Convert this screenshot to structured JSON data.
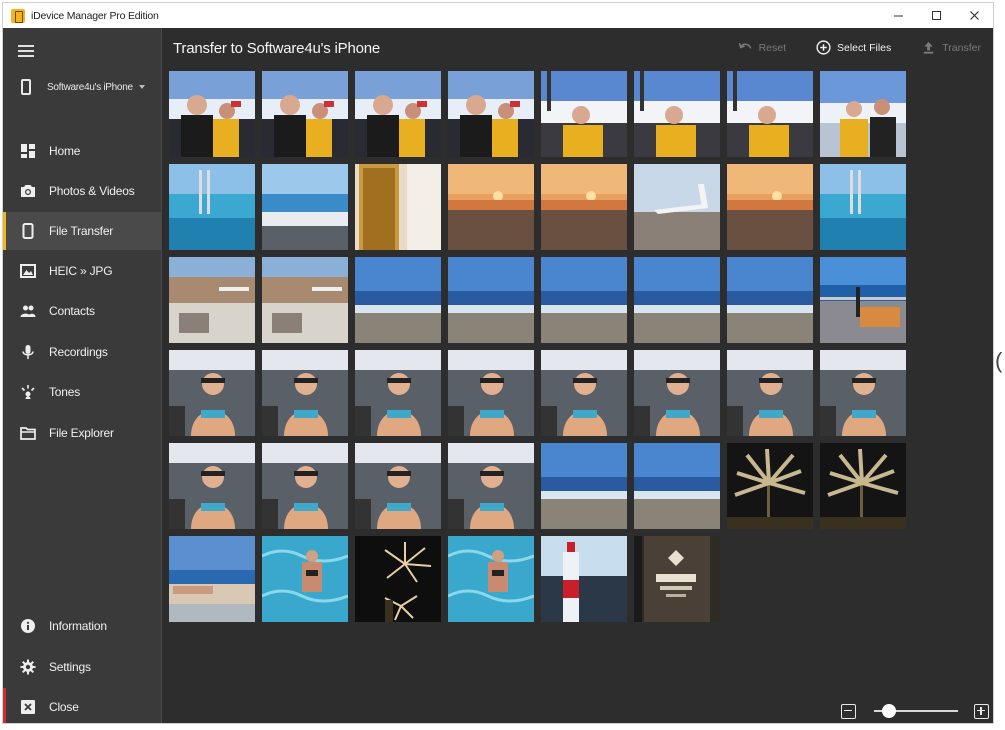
{
  "window": {
    "title": "iDevice Manager Pro Edition",
    "controls": [
      "minimize-icon",
      "maximize-icon",
      "close-icon"
    ]
  },
  "sidebar": {
    "device": "Software4u's iPhone",
    "items": [
      {
        "label": "Home",
        "icon": "home-icon"
      },
      {
        "label": "Photos & Videos",
        "icon": "camera-icon"
      },
      {
        "label": "File Transfer",
        "icon": "phone-icon",
        "active": true
      },
      {
        "label": "HEIC » JPG",
        "icon": "image-convert-icon"
      },
      {
        "label": "Contacts",
        "icon": "contacts-icon"
      },
      {
        "label": "Recordings",
        "icon": "microphone-icon"
      },
      {
        "label": "Tones",
        "icon": "tones-icon"
      },
      {
        "label": "File Explorer",
        "icon": "folder-icon"
      }
    ],
    "bottom_items": [
      {
        "label": "Information",
        "icon": "info-icon"
      },
      {
        "label": "Settings",
        "icon": "gear-icon"
      },
      {
        "label": "Close",
        "icon": "close-box-icon"
      }
    ]
  },
  "main": {
    "title": "Transfer to Software4u's iPhone",
    "toolbar": {
      "reset": "Reset",
      "select_files": "Select Files",
      "transfer": "Transfer"
    }
  },
  "thumbnails": [
    {
      "scene": "ski-selfie"
    },
    {
      "scene": "ski-selfie"
    },
    {
      "scene": "ski-selfie"
    },
    {
      "scene": "ski-selfie"
    },
    {
      "scene": "ski-lift"
    },
    {
      "scene": "ski-lift"
    },
    {
      "scene": "ski-lift"
    },
    {
      "scene": "ski-couple"
    },
    {
      "scene": "pool"
    },
    {
      "scene": "beach"
    },
    {
      "scene": "door"
    },
    {
      "scene": "sunset"
    },
    {
      "scene": "sunset"
    },
    {
      "scene": "airport"
    },
    {
      "scene": "sunset"
    },
    {
      "scene": "pool"
    },
    {
      "scene": "terrace"
    },
    {
      "scene": "terrace"
    },
    {
      "scene": "sea"
    },
    {
      "scene": "sea"
    },
    {
      "scene": "sea"
    },
    {
      "scene": "sea"
    },
    {
      "scene": "sea"
    },
    {
      "scene": "balcony-pool"
    },
    {
      "scene": "selfie-bikini"
    },
    {
      "scene": "selfie-bikini"
    },
    {
      "scene": "selfie-bikini"
    },
    {
      "scene": "selfie-bikini"
    },
    {
      "scene": "selfie-bikini"
    },
    {
      "scene": "selfie-bikini"
    },
    {
      "scene": "selfie-bikini"
    },
    {
      "scene": "selfie-bikini"
    },
    {
      "scene": "selfie-bikini"
    },
    {
      "scene": "selfie-bikini"
    },
    {
      "scene": "selfie-bikini"
    },
    {
      "scene": "selfie-bikini"
    },
    {
      "scene": "sea"
    },
    {
      "scene": "sea"
    },
    {
      "scene": "palm-night"
    },
    {
      "scene": "palm-night"
    },
    {
      "scene": "beach-town"
    },
    {
      "scene": "swimming"
    },
    {
      "scene": "fireworks"
    },
    {
      "scene": "swimming"
    },
    {
      "scene": "bottle"
    },
    {
      "scene": "sign"
    }
  ],
  "zoom": {
    "level": 0.12
  },
  "colors": {
    "accent": "#f2b51b",
    "close_accent": "#d12d2d",
    "background": "#2d2d2d",
    "sidebar": "#3a3a3a"
  }
}
